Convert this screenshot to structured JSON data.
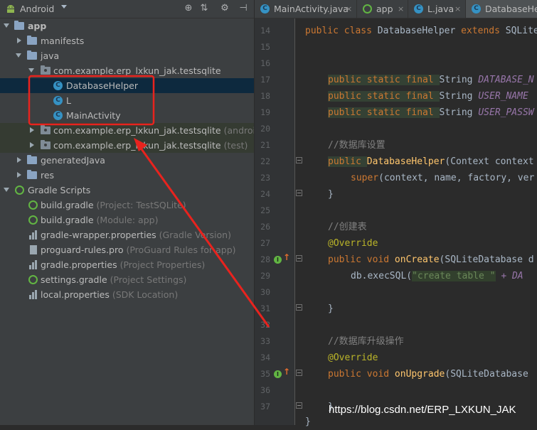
{
  "project_panel": {
    "view_selector": "Android",
    "toolbar_icons": [
      "globe-icon",
      "collapse-icon",
      "gear-icon",
      "hide-icon"
    ],
    "tree": [
      {
        "label": "app",
        "hint": "",
        "icon": "folder-icon"
      },
      {
        "label": "manifests",
        "hint": "",
        "icon": "folder-icon"
      },
      {
        "label": "java",
        "hint": "",
        "icon": "folder-icon"
      },
      {
        "label": "com.example.erp_lxkun_jak.testsqlite",
        "hint": "",
        "icon": "package-icon"
      },
      {
        "label": "DatabaseHelper",
        "hint": "",
        "icon": "class-icon"
      },
      {
        "label": "L",
        "hint": "",
        "icon": "class-icon"
      },
      {
        "label": "MainActivity",
        "hint": "",
        "icon": "class-icon"
      },
      {
        "label": "com.example.erp_lxkun_jak.testsqlite",
        "hint": "(androidTest)",
        "icon": "package-icon"
      },
      {
        "label": "com.example.erp_lxkun_jak.testsqlite",
        "hint": "(test)",
        "icon": "package-icon"
      },
      {
        "label": "generatedJava",
        "hint": "",
        "icon": "folder-icon"
      },
      {
        "label": "res",
        "hint": "",
        "icon": "folder-icon"
      },
      {
        "label": "Gradle Scripts",
        "hint": "",
        "icon": "gradle-icon"
      },
      {
        "label": "build.gradle",
        "hint": "(Project: TestSQLite)",
        "icon": "gradle-icon"
      },
      {
        "label": "build.gradle",
        "hint": "(Module: app)",
        "icon": "gradle-icon"
      },
      {
        "label": "gradle-wrapper.properties",
        "hint": "(Gradle Version)",
        "icon": "properties-icon"
      },
      {
        "label": "proguard-rules.pro",
        "hint": "(ProGuard Rules for app)",
        "icon": "file-icon"
      },
      {
        "label": "gradle.properties",
        "hint": "(Project Properties)",
        "icon": "properties-icon"
      },
      {
        "label": "settings.gradle",
        "hint": "(Project Settings)",
        "icon": "gradle-icon"
      },
      {
        "label": "local.properties",
        "hint": "(SDK Location)",
        "icon": "properties-icon"
      }
    ]
  },
  "editor": {
    "tabs": [
      {
        "label": "MainActivity.java",
        "icon": "class-icon"
      },
      {
        "label": "app",
        "icon": "gradle-icon"
      },
      {
        "label": "L.java",
        "icon": "class-icon"
      },
      {
        "label": "DatabaseHe",
        "icon": "class-icon"
      }
    ],
    "line_numbers": [
      "14",
      "15",
      "16",
      "17",
      "18",
      "19",
      "20",
      "21",
      "22",
      "23",
      "24",
      "25",
      "26",
      "27",
      "28",
      "29",
      "30",
      "31",
      "32",
      "33",
      "34",
      "35",
      "36",
      "37"
    ],
    "code": {
      "l14": {
        "kw": "public class ",
        "name": "DatabaseHelper ",
        "kw2": "extends ",
        "rest": "SQLite"
      },
      "l17": {
        "kw": "public static final ",
        "type": "String ",
        "const": "DATABASE_N"
      },
      "l18": {
        "kw": "public static final ",
        "type": "String ",
        "const": "USER_NAME"
      },
      "l19": {
        "kw": "public static final ",
        "type": "String ",
        "const": "USER_PASSW"
      },
      "l21": "//数据库设置",
      "l22": {
        "kw": "public ",
        "fn": "DatabaseHelper",
        "rest": "(Context context"
      },
      "l23": {
        "kw": "super",
        "rest": "(context, name, factory, ver"
      },
      "l24": "}",
      "l26": "//创建表",
      "l27": "@Override",
      "l28": {
        "kw": "public void ",
        "fn": "onCreate",
        "rest": "(SQLiteDatabase d"
      },
      "l29": {
        "pre": "db.execSQL(",
        "str": "\"create table \"",
        "rest": " + DA"
      },
      "l31": "}",
      "l33": "//数据库升级操作",
      "l34": "@Override",
      "l35": {
        "kw": "public void ",
        "fn": "onUpgrade",
        "rest": "(SQLiteDatabase"
      },
      "l37": "}",
      "l38": "}"
    },
    "gutter_markers": [
      "override-marker-icon",
      "override-marker-icon"
    ]
  },
  "watermark": "https://blog.csdn.net/ERP_LXKUN_JAK",
  "annotation": {
    "box_color": "#e8231e",
    "arrow_color": "#e8231e"
  }
}
